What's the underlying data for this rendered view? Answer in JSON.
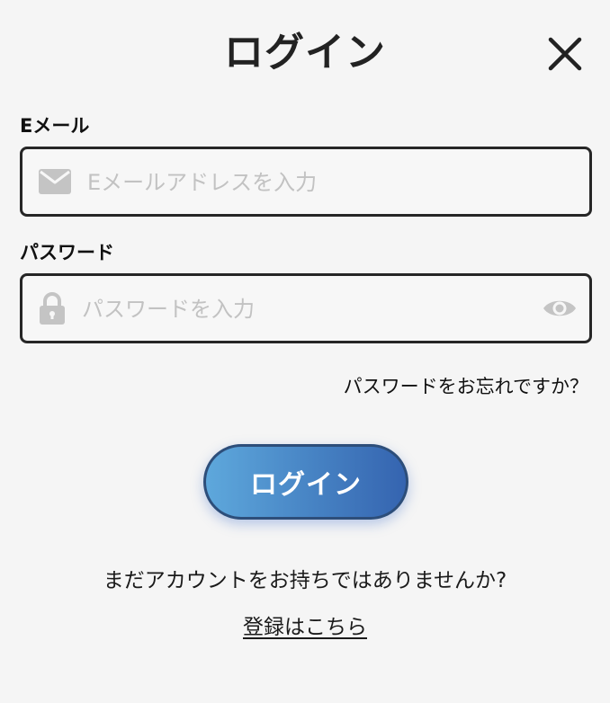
{
  "header": {
    "title": "ログイン"
  },
  "email": {
    "label": "Eメール",
    "placeholder": "Eメールアドレスを入力",
    "value": ""
  },
  "password": {
    "label": "パスワード",
    "placeholder": "パスワードを入力",
    "value": ""
  },
  "links": {
    "forgot_password": "パスワードをお忘れですか？",
    "no_account": "まだアカウントをお持ちではありませんか?",
    "register": "登録はこちら"
  },
  "actions": {
    "login_label": "ログイン"
  },
  "icons": {
    "close": "close-icon",
    "email": "mail-icon",
    "password": "lock-icon",
    "toggle_visibility": "eye-icon"
  },
  "colors": {
    "background": "#f5f5f5",
    "text": "#1a1a1a",
    "input_border": "#262626",
    "placeholder": "#c2c2c2",
    "icon_gray": "#c4c4c4",
    "button_gradient_start": "#5ea8dc",
    "button_gradient_end": "#3564b0",
    "button_border": "#2d4e7a"
  }
}
